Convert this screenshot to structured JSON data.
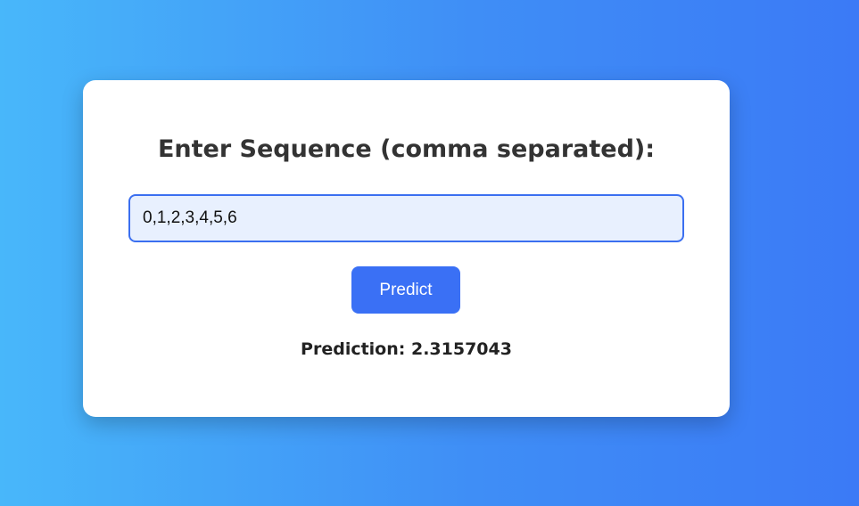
{
  "form": {
    "heading": "Enter Sequence (comma separated):",
    "input_value": "0,1,2,3,4,5,6",
    "predict_label": "Predict",
    "result_text": "Prediction: 2.3157043"
  },
  "colors": {
    "accent": "#3a70f5",
    "input_bg": "#e8f0fe",
    "bg_left": "#48b7fa",
    "bg_right": "#3b7af6"
  }
}
